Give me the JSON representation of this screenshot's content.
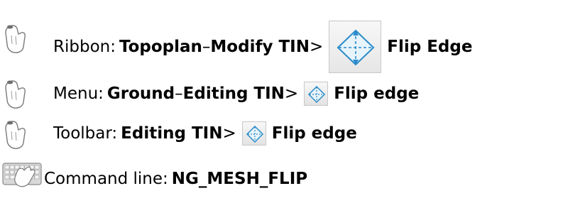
{
  "rows": [
    {
      "icon": "mouse-hand-icon",
      "prefix": "Ribbon: ",
      "part1": "Topoplan",
      "dash": " – ",
      "part2": "Modify TIN",
      "arrow": " > ",
      "tool_icon": "flip-edge-icon",
      "command": "Flip Edge"
    },
    {
      "icon": "mouse-hand-icon",
      "prefix": "Menu: ",
      "part1": "Ground",
      "dash": " – ",
      "part2": "Editing TIN",
      "arrow": " > ",
      "tool_icon": "flip-edge-icon",
      "command": "Flip edge"
    },
    {
      "icon": "mouse-hand-icon",
      "prefix": "Toolbar: ",
      "part1": "Editing TIN",
      "arrow": " > ",
      "tool_icon": "flip-edge-icon",
      "command": "Flip edge"
    },
    {
      "icon": "keyboard-hand-icon",
      "prefix": "Command line: ",
      "command": "NG_MESH_FLIP"
    }
  ]
}
